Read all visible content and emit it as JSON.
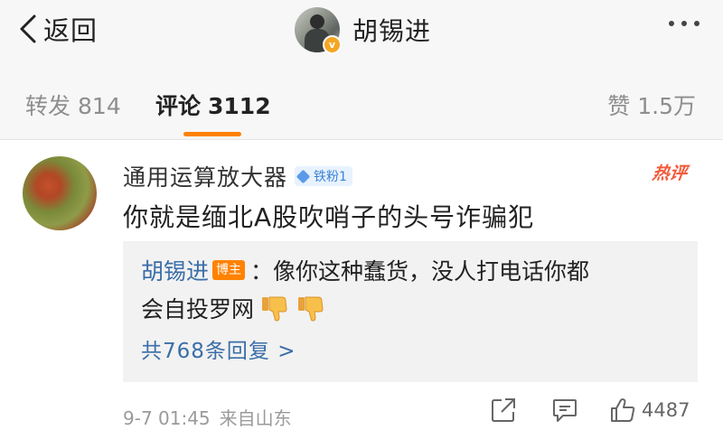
{
  "nav": {
    "back_label": "返回",
    "title": "胡锡进",
    "verified_badge": "v"
  },
  "tabs": {
    "repost": {
      "label": "转发",
      "count": "814"
    },
    "comment": {
      "label": "评论",
      "count": "3112"
    },
    "like": {
      "label": "赞",
      "count": "1.5万"
    },
    "active": "comment",
    "accent_color": "#ff8200"
  },
  "comment": {
    "username": "通用运算放大器",
    "fan_badge": "铁粉1",
    "hot_tag": "热评",
    "text": "你就是缅北A股吹哨子的头号诈骗犯",
    "reply": {
      "author": "胡锡进",
      "author_tag": "博主",
      "text_line1": "：像你这种蠢货，没人打电话你都",
      "text_line2": "会自投罗网",
      "emoji": [
        "thumbs-down-emoji",
        "thumbs-down-emoji"
      ],
      "more_label": "共768条回复 >"
    },
    "time": "9-7 01:45",
    "source": "来自山东",
    "like_count": "4487"
  },
  "colors": {
    "link": "#3b6ea8",
    "hot": "#f25a3a",
    "badge_bg": "#e8f2ff"
  }
}
